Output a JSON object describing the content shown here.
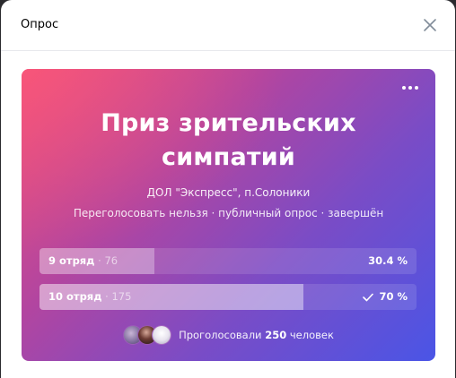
{
  "modal": {
    "title": "Опрос"
  },
  "poll": {
    "title_line1": "Приз зрительских",
    "title_line2": "симпатий",
    "author": "ДОЛ \"Экспресс\", п.Солоники",
    "meta": "Переголосовать нельзя · публичный опрос · завершён",
    "answers": [
      {
        "label": "9 отряд",
        "separator": " · ",
        "count": "76",
        "percent": "30.4 %",
        "fraction": 0.304,
        "voted": false
      },
      {
        "label": "10 отряд",
        "separator": " · ",
        "count": "175",
        "percent": "70 %",
        "fraction": 0.7,
        "voted": true
      }
    ],
    "voters_prefix": "Проголосовали",
    "voters_count": "250",
    "voters_suffix": "человек"
  },
  "colors": {
    "gradient_start": "#f0507a",
    "gradient_end": "#4a55e6"
  },
  "icons": {
    "close": "close-icon",
    "menu": "more-horizontal-icon",
    "check": "check-icon"
  }
}
